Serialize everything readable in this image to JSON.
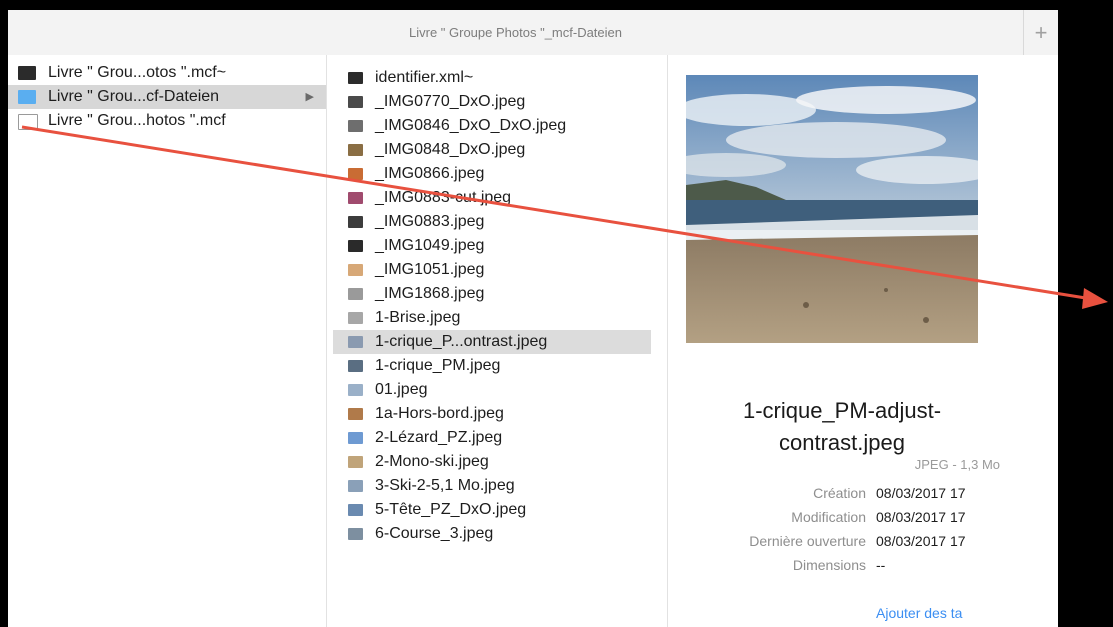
{
  "window": {
    "title": "Livre \" Groupe Photos \"_mcf-Dateien",
    "new_tab_label": "+"
  },
  "column1": [
    {
      "label": "Livre \" Grou...otos \".mcf~",
      "icon": "black-document-icon"
    },
    {
      "label": "Livre \" Grou...cf-Dateien",
      "icon": "folder-icon",
      "selected": true,
      "has_children": true
    },
    {
      "label": "Livre \" Grou...hotos \".mcf",
      "icon": "blank-document-icon"
    }
  ],
  "column1_disclosure": "▶",
  "column2": [
    {
      "label": "identifier.xml~",
      "icon": "black-document-icon"
    },
    {
      "label": "_IMG0770_DxO.jpeg",
      "icon": "image-thumbnail-icon"
    },
    {
      "label": "_IMG0846_DxO_DxO.jpeg",
      "icon": "image-thumbnail-icon"
    },
    {
      "label": "_IMG0848_DxO.jpeg",
      "icon": "image-thumbnail-icon"
    },
    {
      "label": "_IMG0866.jpeg",
      "icon": "image-thumbnail-icon"
    },
    {
      "label": "_IMG0883-cut.jpeg",
      "icon": "image-thumbnail-icon"
    },
    {
      "label": "_IMG0883.jpeg",
      "icon": "image-thumbnail-icon"
    },
    {
      "label": "_IMG1049.jpeg",
      "icon": "image-thumbnail-icon"
    },
    {
      "label": "_IMG1051.jpeg",
      "icon": "image-thumbnail-icon"
    },
    {
      "label": "_IMG1868.jpeg",
      "icon": "image-thumbnail-icon"
    },
    {
      "label": "1-Brise.jpeg",
      "icon": "image-thumbnail-icon"
    },
    {
      "label": "1-crique_P...ontrast.jpeg",
      "icon": "image-thumbnail-icon",
      "selected": true
    },
    {
      "label": "1-crique_PM.jpeg",
      "icon": "image-thumbnail-icon"
    },
    {
      "label": "01.jpeg",
      "icon": "image-thumbnail-icon"
    },
    {
      "label": "1a-Hors-bord.jpeg",
      "icon": "image-thumbnail-icon"
    },
    {
      "label": "2-Lézard_PZ.jpeg",
      "icon": "image-thumbnail-icon"
    },
    {
      "label": "2-Mono-ski.jpeg",
      "icon": "image-thumbnail-icon"
    },
    {
      "label": "3-Ski-2-5,1 Mo.jpeg",
      "icon": "image-thumbnail-icon"
    },
    {
      "label": "5-Tête_PZ_DxO.jpeg",
      "icon": "image-thumbnail-icon"
    },
    {
      "label": "6-Course_3.jpeg",
      "icon": "image-thumbnail-icon"
    }
  ],
  "preview": {
    "filename": "1-crique_PM-adjust-contrast.jpeg",
    "filename_line1": "1-crique_PM-adjust-",
    "filename_line2": "contrast.jpeg",
    "type_size": "JPEG - 1,3 Mo",
    "info": [
      {
        "label": "Création",
        "value": "08/03/2017 17"
      },
      {
        "label": "Modification",
        "value": "08/03/2017 17"
      },
      {
        "label": "Dernière ouverture",
        "value": "08/03/2017 17"
      },
      {
        "label": "Dimensions",
        "value": "--"
      }
    ],
    "add_tags_link": "Ajouter des ta"
  },
  "annotation": {
    "color": "#e8513f"
  }
}
